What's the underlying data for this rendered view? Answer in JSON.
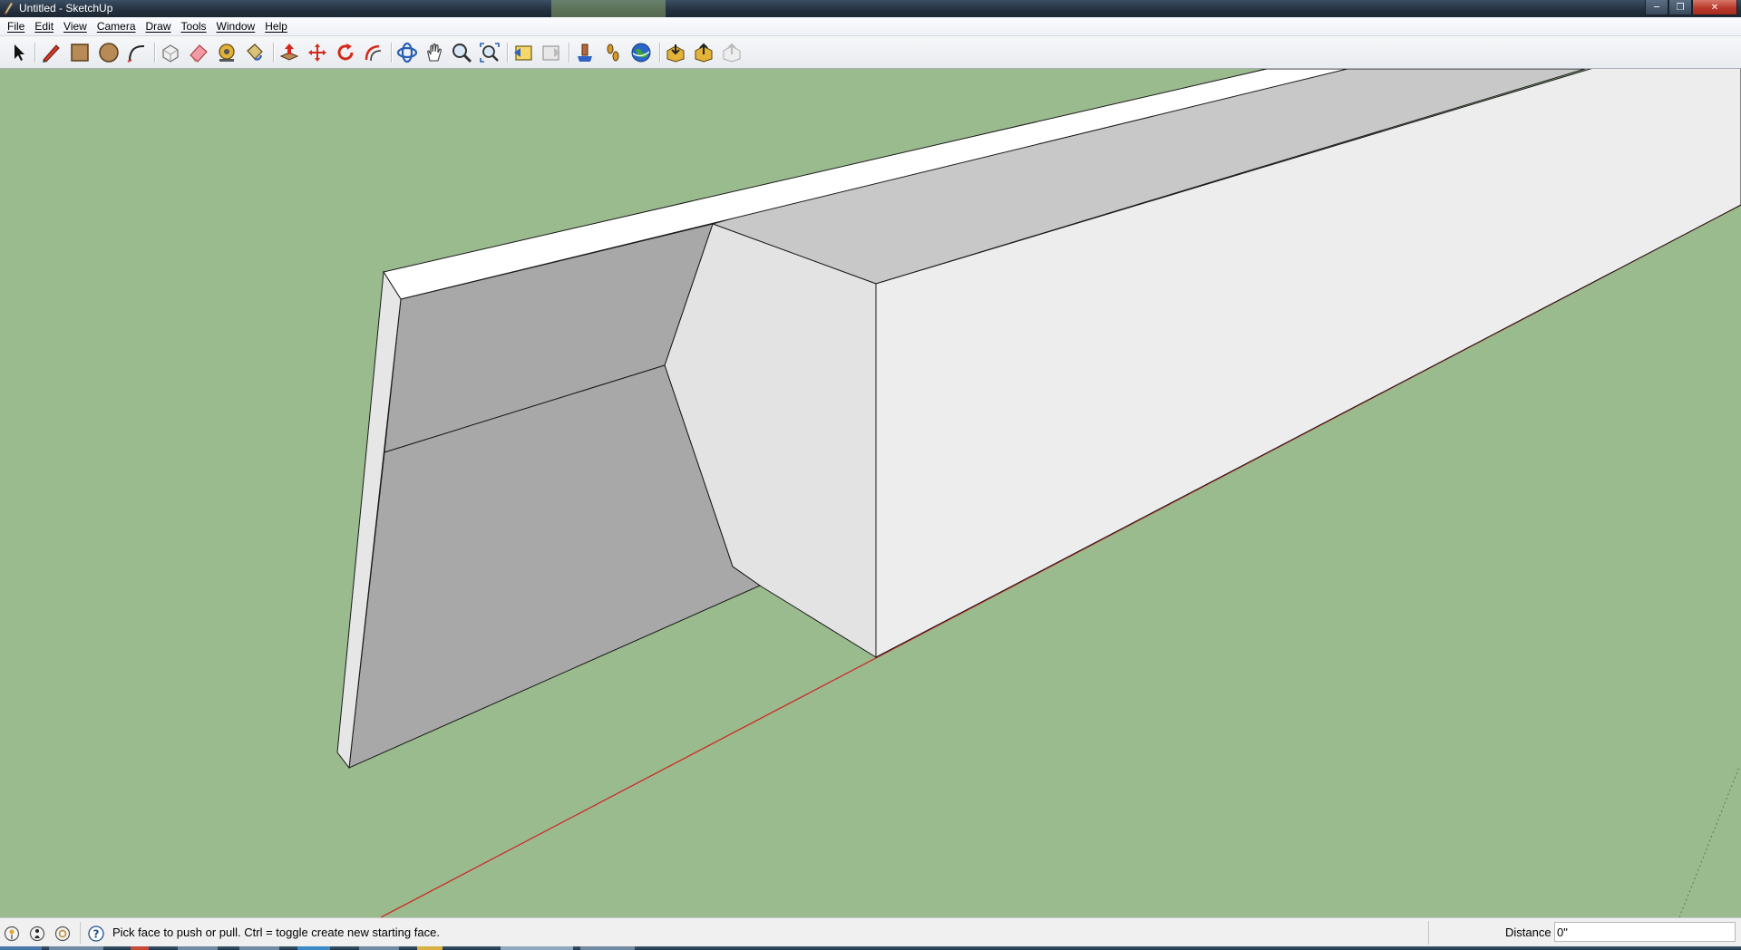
{
  "window": {
    "title": "Untitled - SketchUp",
    "controls": [
      "minimize",
      "maximize",
      "close"
    ]
  },
  "menu": {
    "items": [
      {
        "label": "File"
      },
      {
        "label": "Edit"
      },
      {
        "label": "View"
      },
      {
        "label": "Camera"
      },
      {
        "label": "Draw"
      },
      {
        "label": "Tools"
      },
      {
        "label": "Window"
      },
      {
        "label": "Help"
      }
    ]
  },
  "toolbar": {
    "tools": [
      "select-tool",
      "line-tool",
      "rectangle-tool",
      "circle-tool",
      "arc-tool",
      "make-component-tool",
      "eraser-tool",
      "tape-measure-tool",
      "paint-bucket-tool",
      "push-pull-tool",
      "move-tool",
      "rotate-tool",
      "offset-tool",
      "orbit-tool",
      "pan-tool",
      "zoom-tool",
      "zoom-extents-tool",
      "previous-view-tool",
      "next-view-tool",
      "position-camera-tool",
      "walk-tool",
      "look-around-tool",
      "get-models-tool",
      "share-model-tool",
      "share-component-tool"
    ]
  },
  "viewport": {
    "background_color": "#9abb8e",
    "model_face_colors": {
      "light": "#ededed",
      "mid": "#c8c8c8",
      "dark": "#a8a8a8",
      "top_edge": "#ffffff",
      "side_strip": "#e6e6e6"
    },
    "red_axis_color": "#cc2b2b"
  },
  "status": {
    "hint": "Pick face to push or pull.  Ctrl = toggle create new starting face.",
    "measurement_label": "Distance",
    "measurement_value": "0\""
  }
}
